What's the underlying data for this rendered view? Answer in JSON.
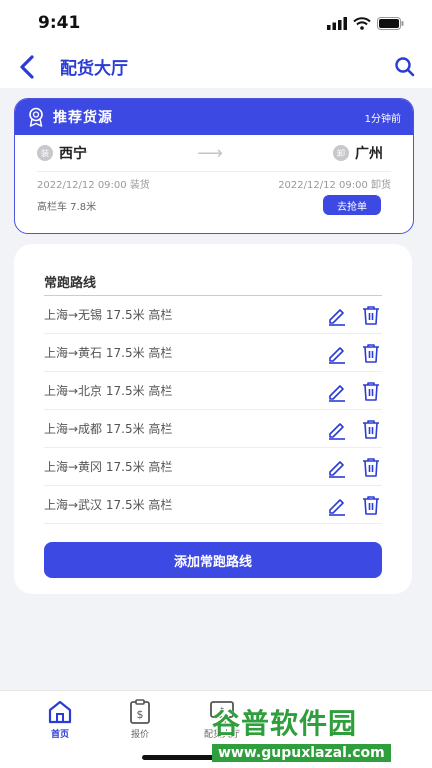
{
  "status": {
    "time": "9:41"
  },
  "nav": {
    "title": "配货大厅"
  },
  "recommend": {
    "title": "推荐货源",
    "time_ago": "1分钟前",
    "from_badge": "装",
    "from_city": "西宁",
    "to_badge": "卸",
    "to_city": "广州",
    "load_date": "2022/12/12  09:00  装货",
    "unload_date": "2022/12/12  09:00  卸货",
    "truck_info": "高栏车  7.8米",
    "grab_label": "去抢单"
  },
  "routes": {
    "title": "常跑路线",
    "items": [
      {
        "text": "上海→无锡  17.5米  高栏"
      },
      {
        "text": "上海→黄石  17.5米  高栏"
      },
      {
        "text": "上海→北京  17.5米  高栏"
      },
      {
        "text": "上海→成都  17.5米  高栏"
      },
      {
        "text": "上海→黄冈  17.5米  高栏"
      },
      {
        "text": "上海→武汉  17.5米  高栏"
      }
    ],
    "add_label": "添加常跑路线"
  },
  "tabs": [
    {
      "label": "首页",
      "icon": "home-icon"
    },
    {
      "label": "报价",
      "icon": "quote-icon"
    },
    {
      "label": "配货大厅",
      "icon": "monitor-icon"
    }
  ],
  "watermark": {
    "top": "谷普软件园",
    "bottom": "www.gupuxlazal.com"
  },
  "colors": {
    "primary": "#3d49e3",
    "background": "#f2f3f7"
  }
}
